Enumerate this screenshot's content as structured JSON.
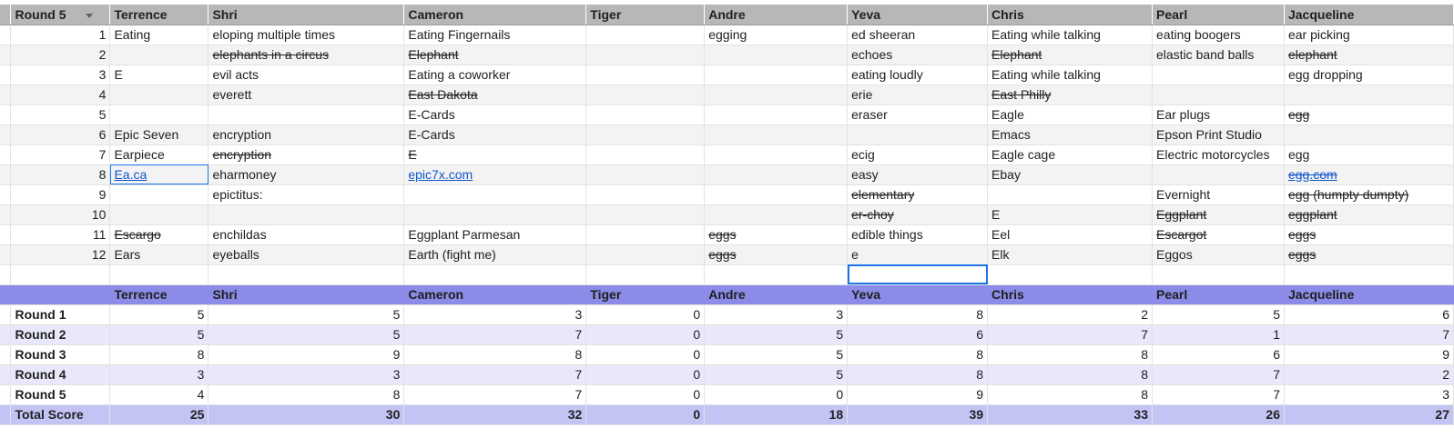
{
  "top": {
    "corner_label": "Round 5",
    "columns": [
      "Terrence",
      "Shri",
      "Cameron",
      "Tiger",
      "Andre",
      "Yeva",
      "Chris",
      "Pearl",
      "Jacqueline"
    ],
    "rows": [
      {
        "num": "1",
        "cells": [
          "Eating",
          "eloping multiple times",
          "Eating Fingernails",
          "",
          "egging",
          "ed sheeran",
          "Eating while talking",
          "eating boogers",
          "ear picking"
        ]
      },
      {
        "num": "2",
        "cells": [
          "",
          "elephants in a circus",
          "Elephant",
          "",
          "",
          "echoes",
          "Elephant",
          "elastic band balls",
          "elephant"
        ]
      },
      {
        "num": "3",
        "cells": [
          "E",
          "evil acts",
          "Eating a coworker",
          "",
          "",
          "eating loudly",
          "Eating while talking",
          "",
          "egg dropping"
        ]
      },
      {
        "num": "4",
        "cells": [
          "",
          "everett",
          "East Dakota",
          "",
          "",
          "erie",
          "East Philly",
          "",
          ""
        ]
      },
      {
        "num": "5",
        "cells": [
          "",
          "",
          "E-Cards",
          "",
          "",
          "eraser",
          "Eagle",
          "Ear plugs",
          "egg"
        ]
      },
      {
        "num": "6",
        "cells": [
          "Epic Seven",
          "encryption",
          "E-Cards",
          "",
          "",
          "",
          "Emacs",
          "Epson Print Studio",
          ""
        ]
      },
      {
        "num": "7",
        "cells": [
          "Earpiece",
          "encryption",
          "E",
          "",
          "",
          "ecig",
          "Eagle cage",
          "Electric motorcycles",
          "egg"
        ]
      },
      {
        "num": "8",
        "cells": [
          "Ea.ca",
          "eharmoney",
          "epic7x.com",
          "",
          "",
          "easy",
          "Ebay",
          "",
          "egg.com"
        ]
      },
      {
        "num": "9",
        "cells": [
          "",
          "epictitus:",
          "",
          "",
          "",
          "elementary",
          "",
          "Evernight",
          "egg (humpty dumpty)"
        ]
      },
      {
        "num": "10",
        "cells": [
          "",
          "",
          "",
          "",
          "",
          "er-choy",
          "E",
          "Eggplant",
          "eggplant"
        ]
      },
      {
        "num": "11",
        "cells": [
          "Escargo",
          "enchildas",
          "Eggplant Parmesan",
          "",
          "eggs",
          "edible things",
          "Eel",
          "Escargot",
          "eggs"
        ]
      },
      {
        "num": "12",
        "cells": [
          "Ears",
          "eyeballs",
          "Earth (fight me)",
          "",
          "eggs",
          "e",
          "Elk",
          "Eggos",
          "eggs"
        ]
      }
    ]
  },
  "scores": {
    "columns": [
      "Terrence",
      "Shri",
      "Cameron",
      "Tiger",
      "Andre",
      "Yeva",
      "Chris",
      "Pearl",
      "Jacqueline"
    ],
    "rows": [
      {
        "label": "Round 1",
        "values": [
          "5",
          "5",
          "3",
          "0",
          "3",
          "8",
          "2",
          "5",
          "6"
        ]
      },
      {
        "label": "Round 2",
        "values": [
          "5",
          "5",
          "7",
          "0",
          "5",
          "6",
          "7",
          "1",
          "7"
        ]
      },
      {
        "label": "Round 3",
        "values": [
          "8",
          "9",
          "8",
          "0",
          "5",
          "8",
          "8",
          "6",
          "9"
        ]
      },
      {
        "label": "Round 4",
        "values": [
          "3",
          "3",
          "7",
          "0",
          "5",
          "8",
          "8",
          "7",
          "2"
        ]
      },
      {
        "label": "Round 5",
        "values": [
          "4",
          "8",
          "7",
          "0",
          "0",
          "9",
          "8",
          "7",
          "3"
        ]
      },
      {
        "label": "Total Score",
        "values": [
          "25",
          "30",
          "32",
          "0",
          "18",
          "39",
          "33",
          "26",
          "27"
        ]
      }
    ]
  },
  "colors": {
    "header_gray": "#b7b7b7",
    "score_header": "#8a8ce8",
    "score_band": "#e8e8fa",
    "total_band": "#c4c4f4",
    "link": "#1155cc",
    "selection": "#1a73e8"
  },
  "icons": {
    "filter": "filter-dropdown-icon"
  }
}
